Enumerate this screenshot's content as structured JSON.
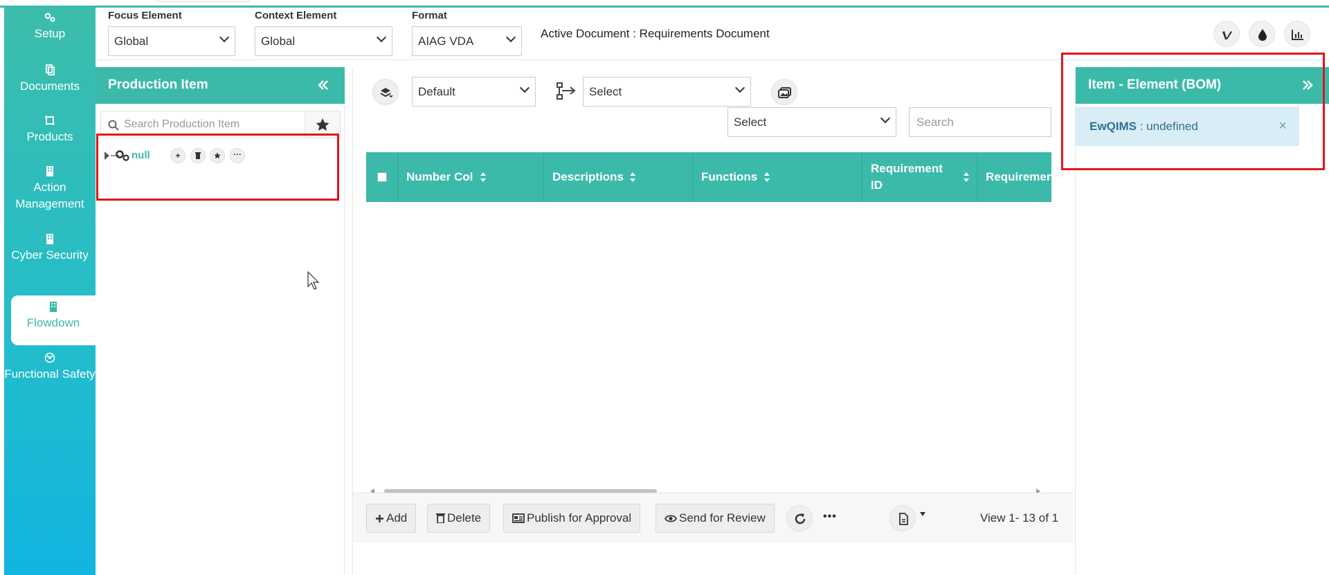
{
  "sidebar": {
    "items": [
      {
        "label": "Setup",
        "icon": "gears-icon"
      },
      {
        "label": "Documents",
        "icon": "documents-icon"
      },
      {
        "label": "Products",
        "icon": "products-icon"
      },
      {
        "label": "Action Management",
        "icon": "building-icon"
      },
      {
        "label": "Cyber Security",
        "icon": "building-icon"
      },
      {
        "label": "Flowdown",
        "icon": "building-icon",
        "active": true
      },
      {
        "label": "Functional Safety",
        "icon": "biohazard-icon"
      }
    ]
  },
  "filters": {
    "focus_label": "Focus Element",
    "focus_value": "Global",
    "context_label": "Context Element",
    "context_value": "Global",
    "format_label": "Format",
    "format_value": "AIAG VDA",
    "active_document": "Active Document : Requirements Document"
  },
  "left_panel": {
    "title": "Production Item",
    "search_placeholder": "Search Production Item",
    "tree_node": "null"
  },
  "grid": {
    "view_select": "Default",
    "flow_select": "Select",
    "filter_select": "Select",
    "search_placeholder": "Search",
    "columns": [
      "Number Col",
      "Descriptions",
      "Functions",
      "Requirement ID",
      "Requirement"
    ],
    "footer": {
      "add": "Add",
      "delete": "Delete",
      "publish": "Publish for Approval",
      "review": "Send for Review",
      "more": "•••",
      "view_count": "View 1- 13 of 1"
    }
  },
  "right_panel": {
    "title": "Item - Element (BOM)",
    "alert_key": "EwQIMS",
    "alert_value": " : undefined",
    "alert_close": "×"
  },
  "colors": {
    "accent": "#3cbaa9",
    "highlight_box": "#e0141a",
    "alert_bg": "#d9edf7"
  }
}
